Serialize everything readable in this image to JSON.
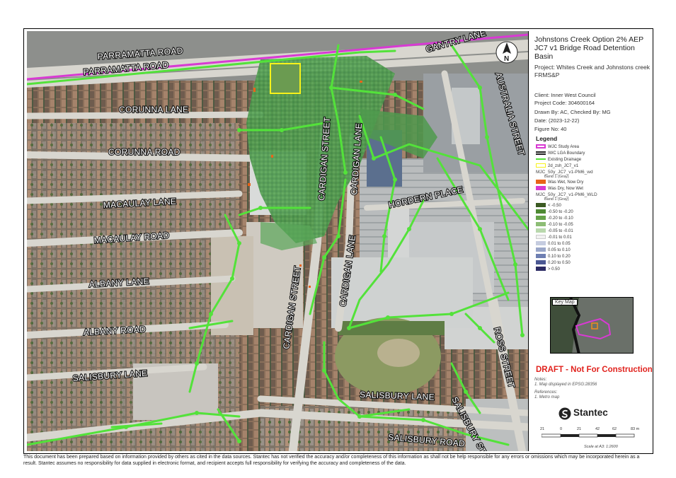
{
  "title": {
    "line1": "Johnstons Creek Option 2% AEP",
    "line2": "JC7 v1 Bridge Road Detention Basin"
  },
  "project": "Project:  Whites Creek and Johnstons creek FRMS&P",
  "client": "Client:  Inner West Council",
  "project_code": "Project Code:  304600164",
  "drawn_by": "Drawn By:  AC, Checked By: MG",
  "date": "Date:  (2023-12-22)",
  "figure_no": "Figure No:  40",
  "north_label": "N",
  "legend": {
    "title": "Legend",
    "items": [
      {
        "label": "WJC Study Area",
        "color": "#d83ad3",
        "style": "outline"
      },
      {
        "label": "IWC LGA Boundary",
        "color": "#222222",
        "style": "double"
      },
      {
        "label": "Existing Drainage",
        "color": "#53e23a",
        "style": "line"
      },
      {
        "label": "2d_zsh_JC7_v1",
        "color": "#f7f21a",
        "style": "outline"
      }
    ],
    "group1_title": "MJC_50y_JC7_v1-PM6_wd",
    "group1_band": "Band 1 (Gray)",
    "group1_items": [
      {
        "label": "Was Wet, Now Dry",
        "color": "#e8641a"
      },
      {
        "label": "Was Dry, Now Wet",
        "color": "#d83ad3"
      }
    ],
    "group2_title": "MJC_50y_JC7_v1-PM6_WLD",
    "group2_band": "Band 1 (Gray)",
    "group2_items": [
      {
        "label": "< -0.50",
        "color": "#3b5a22"
      },
      {
        "label": "-0.50 to -0.20",
        "color": "#4e8a33"
      },
      {
        "label": "-0.20 to -0.10",
        "color": "#66a34a"
      },
      {
        "label": "-0.10 to -0.05",
        "color": "#8dbd75"
      },
      {
        "label": "-0.05 to -0.01",
        "color": "#b9d8ad"
      },
      {
        "label": "-0.01 to 0.01",
        "color": "#f2f2f2"
      },
      {
        "label": "0.01 to 0.05",
        "color": "#c5cce0"
      },
      {
        "label": "0.05 to 0.10",
        "color": "#9aa7c9"
      },
      {
        "label": "0.10 to 0.20",
        "color": "#6e7fb2"
      },
      {
        "label": "0.20 to 0.50",
        "color": "#4a5793"
      },
      {
        "label": "> 0.50",
        "color": "#2b2a63"
      }
    ]
  },
  "key_map_label": "Key Map",
  "draft": "DRAFT - Not For Construction",
  "notes_heading": "Notes:",
  "notes_text": "1. Map displayed in EPSG:28356",
  "references_heading": "References:",
  "references_text": "1. Metro map",
  "brand": "Stantec",
  "scale_bar": {
    "ticks": [
      "21",
      "0",
      "21",
      "42",
      "62",
      "83 m"
    ],
    "caption": "Scale at A3: 1:2600"
  },
  "street_labels": [
    "PARRAMATTA ROAD",
    "PARRAMATTA ROAD",
    "GANTRY LANE",
    "AUSTRALIA STREET",
    "CORUNNA LANE",
    "CORUNNA ROAD",
    "CARDIGAN STREET",
    "CARDIGAN LANE",
    "HORDERN PLACE",
    "MACAULAY LANE",
    "MACAULAY ROAD",
    "ALBANY LANE",
    "CARDIGAN LANE",
    "CARDIGAN STREET",
    "ALBANY ROAD",
    "ROSS STREET",
    "SALISBURY LANE",
    "SALISBURY LANE",
    "SALISBURY STREET",
    "SALISBURY ROAD"
  ],
  "disclaimer": "This document has been prepared based on information provided by others as cited in the data sources. Stantec has not verified the accuracy and/or completeness of this information as shall not be help responsible for any errors or omissions which may be incorporated herein as a result. Stantec assumes no responsibility for data supplied in electronic format, and recipient accepts full responsibility for verifying the accuracy and completeness of the data.",
  "colors": {
    "drainage": "#53e23a",
    "flood_green": "#4e9a4b",
    "study_area": "#d83ad3",
    "detention_basin": "#f7f21a",
    "draft_red": "#e1231e"
  }
}
